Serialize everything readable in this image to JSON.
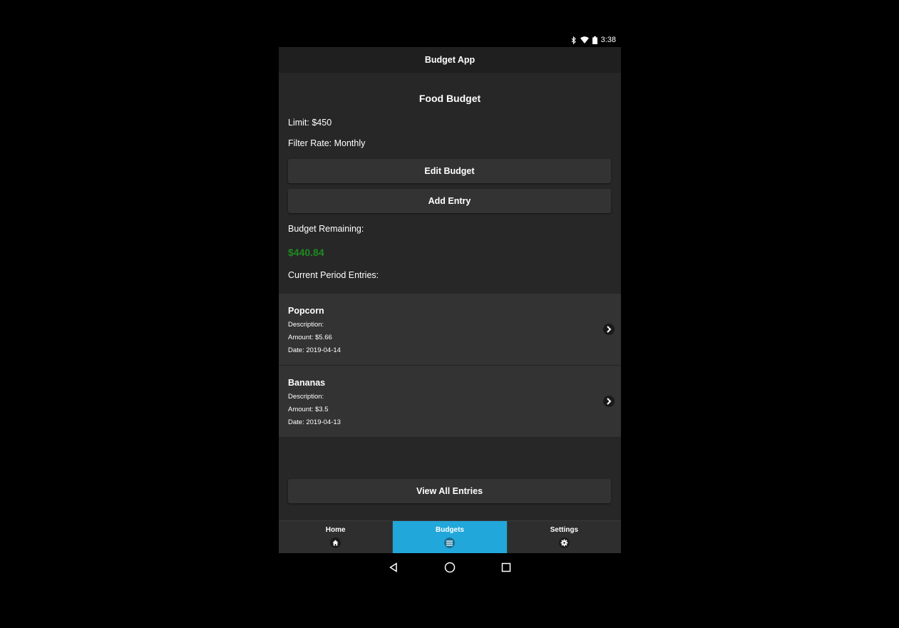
{
  "status_bar": {
    "time": "3:38",
    "icons": [
      "bluetooth-icon",
      "wifi-icon",
      "battery-icon"
    ]
  },
  "app": {
    "title": "Budget App"
  },
  "budget": {
    "title": "Food Budget",
    "limit_text": "Limit: $450",
    "filter_rate_text": "Filter Rate: Monthly",
    "edit_button": "Edit Budget",
    "add_entry_button": "Add Entry",
    "remaining_label": "Budget Remaining:",
    "remaining_amount": "$440.84",
    "entries_label": "Current Period Entries:",
    "view_all_button": "View All Entries"
  },
  "entries": [
    {
      "name": "Popcorn",
      "description": "Description:",
      "amount": "Amount: $5.66",
      "date": "Date: 2019-04-14"
    },
    {
      "name": "Bananas",
      "description": "Description:",
      "amount": "Amount: $3.5",
      "date": "Date: 2019-04-13"
    }
  ],
  "tabs": [
    {
      "label": "Home",
      "icon": "home-icon",
      "active": false
    },
    {
      "label": "Budgets",
      "icon": "list-icon",
      "active": true
    },
    {
      "label": "Settings",
      "icon": "gear-icon",
      "active": false
    }
  ],
  "colors": {
    "accent": "#22a7db",
    "remaining_positive": "#1f8a1f",
    "background": "#272727",
    "header": "#1f1f1f"
  }
}
